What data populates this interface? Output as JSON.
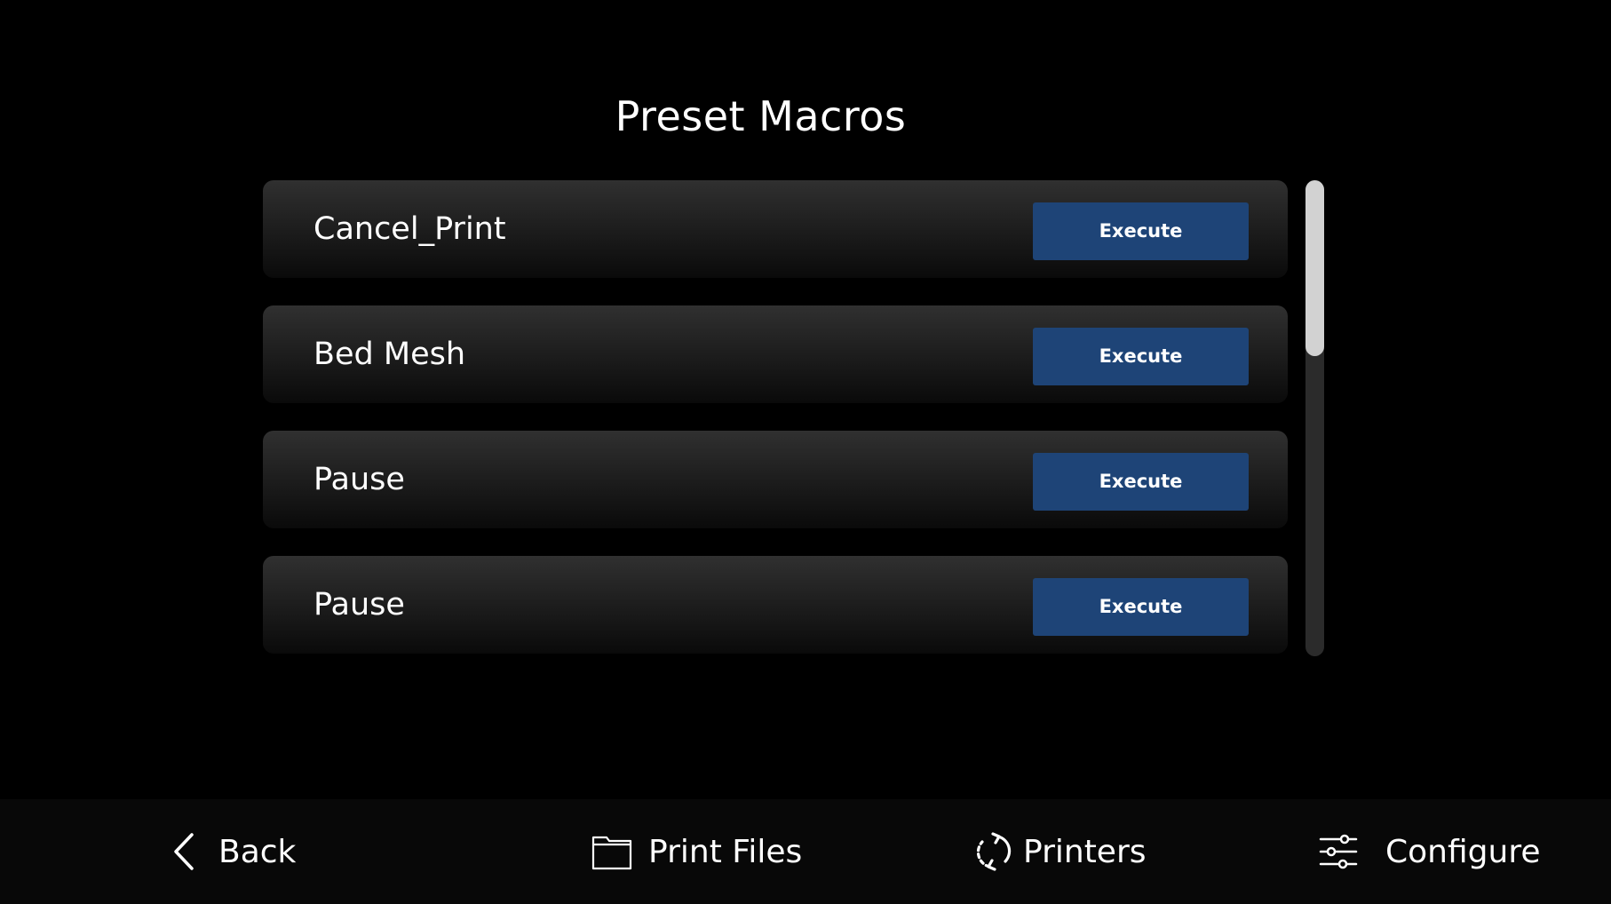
{
  "page": {
    "title": "Preset Macros"
  },
  "macros": [
    {
      "name": "Cancel_Print",
      "button_label": "Execute"
    },
    {
      "name": "Bed Mesh",
      "button_label": "Execute"
    },
    {
      "name": "Pause",
      "button_label": "Execute"
    },
    {
      "name": "Pause",
      "button_label": "Execute"
    }
  ],
  "bottom_nav": {
    "back": {
      "label": "Back",
      "icon": "chevron-left-icon"
    },
    "print_files": {
      "label": "Print Files",
      "icon": "folder-icon"
    },
    "printers": {
      "label": "Printers",
      "icon": "cycle-arrows-icon"
    },
    "configure": {
      "label": "Configure",
      "icon": "sliders-icon"
    }
  },
  "colors": {
    "background": "#000000",
    "row_top": "#303030",
    "execute_button": "#1e4477",
    "scrollbar_thumb": "#d2d2d2",
    "scrollbar_track": "#2b2b2b"
  }
}
